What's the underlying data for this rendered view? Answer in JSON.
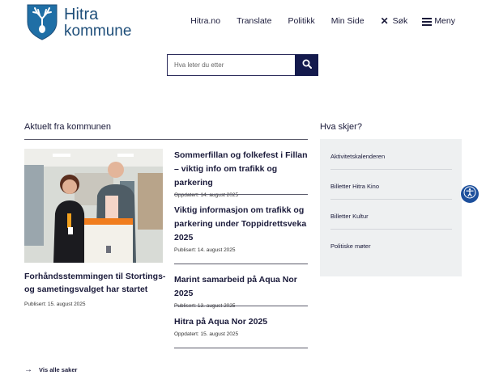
{
  "header": {
    "logo_line1": "Hitra",
    "logo_line2": "kommune",
    "nav": [
      "Hitra.no",
      "Translate",
      "Politikk",
      "Min Side"
    ],
    "search_label": "Søk",
    "menu_label": "Meny"
  },
  "search": {
    "placeholder": "Hva leter du etter"
  },
  "news": {
    "heading": "Aktuelt fra kommunen",
    "feature": {
      "title": "Forhåndsstemmingen til Stortings- og sametingsvalget har startet",
      "date": "Publisert: 15. august 2025"
    },
    "items": [
      {
        "title": "Sommerfillan og folkefest i Fillan – viktig info om trafikk og parkering",
        "date": "Oppdatert: 14. august 2025"
      },
      {
        "title": "Viktig informasjon om trafikk og parkering under Toppidrettsveka 2025",
        "date": "Publisert: 14. august 2025"
      },
      {
        "title": "Marint samarbeid på Aqua Nor 2025",
        "date": "Publisert: 13. august 2025"
      },
      {
        "title": "Hitra på Aqua Nor 2025",
        "date": "Oppdatert: 15. august 2025"
      }
    ],
    "all_link": "Vis alle saker"
  },
  "events": {
    "heading": "Hva skjer?",
    "links": [
      "Aktivitetskalenderen",
      "Billetter Hitra Kino",
      "Billetter Kultur",
      "Politiske møter"
    ]
  },
  "colors": {
    "primary_dark": "#141a4d",
    "logo_blue": "#1f4f7a",
    "accessibility_blue": "#1c4f9c",
    "panel_bg": "#eef0f1"
  },
  "icons": {
    "logo": "hitra-coat-of-arms-icon",
    "search": "magnifier-icon",
    "close": "close-icon",
    "menu": "hamburger-icon",
    "arrow": "arrow-right-icon",
    "accessibility": "accessibility-icon"
  }
}
